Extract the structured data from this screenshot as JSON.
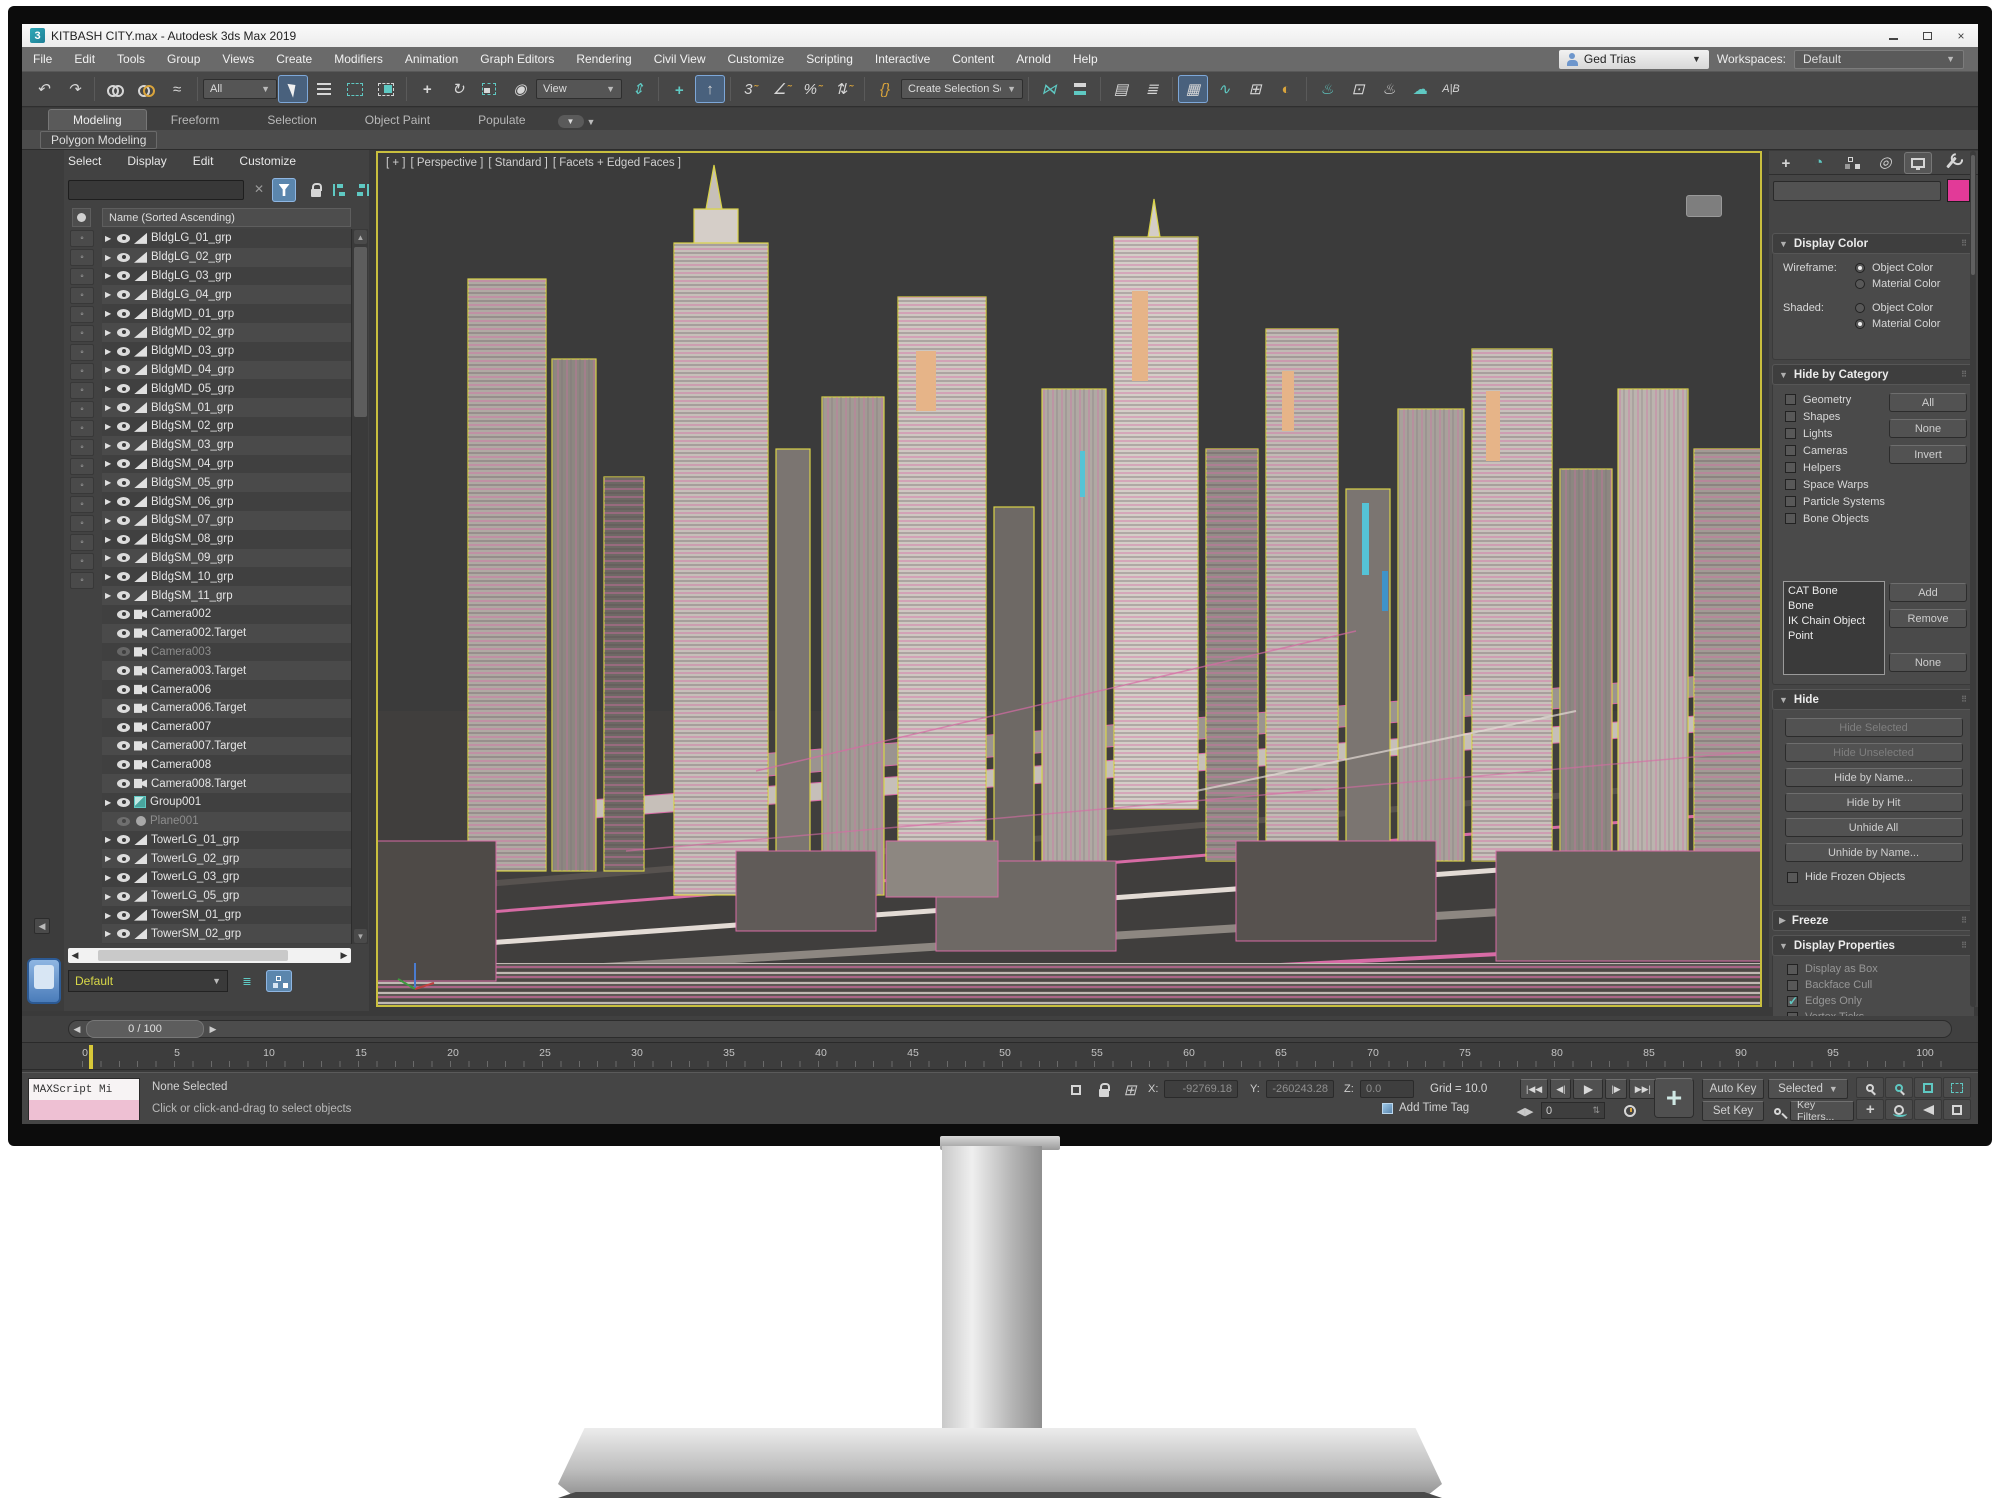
{
  "window": {
    "title": "KITBASH CITY.max - Autodesk 3ds Max 2019",
    "logo": "3"
  },
  "menubar": {
    "items": [
      "File",
      "Edit",
      "Tools",
      "Group",
      "Views",
      "Create",
      "Modifiers",
      "Animation",
      "Graph Editors",
      "Rendering",
      "Civil View",
      "Customize",
      "Scripting",
      "Interactive",
      "Content",
      "Arnold",
      "Help"
    ],
    "user": "Ged Trias",
    "workspaces_label": "Workspaces:",
    "workspace_value": "Default"
  },
  "toolbar": {
    "selection_filter": "All",
    "reference_coordinate": "View",
    "named_sets": "Create Selection Se",
    "icon_names": [
      "undo",
      "redo",
      "select-and-link",
      "unlink-selection",
      "bind-to-space-warp",
      "select-object",
      "select-by-name",
      "rectangular-selection-region",
      "window-crossing",
      "select-and-move",
      "select-and-rotate",
      "select-and-scale",
      "select-and-place",
      "use-pivot-point-center",
      "select-and-manipulate",
      "keyboard-shortcut-override",
      "snap-toggle-3d",
      "angle-snap",
      "percent-snap",
      "spinner-snap",
      "edit-named-selection-sets",
      "mirror",
      "align",
      "toggle-scene-explorer",
      "toggle-layer-explorer",
      "toggle-ribbon",
      "curve-editor",
      "schematic-view",
      "material-editor",
      "render-setup",
      "rendered-frame-window",
      "render-production",
      "render-in-cloud",
      "state-sets"
    ]
  },
  "ribbon": {
    "tabs": [
      {
        "label": "Modeling",
        "active": true
      },
      {
        "label": "Freeform"
      },
      {
        "label": "Selection"
      },
      {
        "label": "Object Paint"
      },
      {
        "label": "Populate"
      }
    ],
    "panel": "Polygon Modeling"
  },
  "explorer": {
    "menus": [
      "Select",
      "Display",
      "Edit",
      "Customize"
    ],
    "column_header": "Name (Sorted Ascending)",
    "side_icons": [
      "select-cursor",
      "geometry",
      "shapes",
      "lights",
      "cameras",
      "helpers",
      "space-warps",
      "particle-systems",
      "bones",
      "ik-objects",
      "containers",
      "materials",
      "layers",
      "groups",
      "xrefs",
      "display-frozen",
      "display-hidden",
      "sort",
      "pin"
    ],
    "items": [
      {
        "name": "BldgLG_01_grp",
        "icon": "grp"
      },
      {
        "name": "BldgLG_02_grp",
        "icon": "grp"
      },
      {
        "name": "BldgLG_03_grp",
        "icon": "grp"
      },
      {
        "name": "BldgLG_04_grp",
        "icon": "grp"
      },
      {
        "name": "BldgMD_01_grp",
        "icon": "grp"
      },
      {
        "name": "BldgMD_02_grp",
        "icon": "grp"
      },
      {
        "name": "BldgMD_03_grp",
        "icon": "grp"
      },
      {
        "name": "BldgMD_04_grp",
        "icon": "grp"
      },
      {
        "name": "BldgMD_05_grp",
        "icon": "grp"
      },
      {
        "name": "BldgSM_01_grp",
        "icon": "grp"
      },
      {
        "name": "BldgSM_02_grp",
        "icon": "grp"
      },
      {
        "name": "BldgSM_03_grp",
        "icon": "grp"
      },
      {
        "name": "BldgSM_04_grp",
        "icon": "grp"
      },
      {
        "name": "BldgSM_05_grp",
        "icon": "grp"
      },
      {
        "name": "BldgSM_06_grp",
        "icon": "grp"
      },
      {
        "name": "BldgSM_07_grp",
        "icon": "grp"
      },
      {
        "name": "BldgSM_08_grp",
        "icon": "grp"
      },
      {
        "name": "BldgSM_09_grp",
        "icon": "grp"
      },
      {
        "name": "BldgSM_10_grp",
        "icon": "grp"
      },
      {
        "name": "BldgSM_11_grp",
        "icon": "grp"
      },
      {
        "name": "Camera002",
        "icon": "cam",
        "noarrow": true
      },
      {
        "name": "Camera002.Target",
        "icon": "cam",
        "noarrow": true
      },
      {
        "name": "Camera003",
        "icon": "cam",
        "noarrow": true,
        "dim": true
      },
      {
        "name": "Camera003.Target",
        "icon": "cam",
        "noarrow": true
      },
      {
        "name": "Camera006",
        "icon": "cam",
        "noarrow": true
      },
      {
        "name": "Camera006.Target",
        "icon": "cam",
        "noarrow": true
      },
      {
        "name": "Camera007",
        "icon": "cam",
        "noarrow": true
      },
      {
        "name": "Camera007.Target",
        "icon": "cam",
        "noarrow": true
      },
      {
        "name": "Camera008",
        "icon": "cam",
        "noarrow": true
      },
      {
        "name": "Camera008.Target",
        "icon": "cam",
        "noarrow": true
      },
      {
        "name": "Group001",
        "icon": "group"
      },
      {
        "name": "Plane001",
        "icon": "plane",
        "noarrow": true,
        "dim": true
      },
      {
        "name": "TowerLG_01_grp",
        "icon": "grp"
      },
      {
        "name": "TowerLG_02_grp",
        "icon": "grp"
      },
      {
        "name": "TowerLG_03_grp",
        "icon": "grp"
      },
      {
        "name": "TowerLG_05_grp",
        "icon": "grp"
      },
      {
        "name": "TowerSM_01_grp",
        "icon": "grp"
      },
      {
        "name": "TowerSM_02_grp",
        "icon": "grp"
      }
    ],
    "layer_value": "Default"
  },
  "viewport": {
    "label_general": "[ + ]",
    "label_pov": "[ Perspective ]",
    "label_style": "[ Standard ]",
    "label_shading": "[ Facets + Edged Faces ]"
  },
  "cp": {
    "object_color": "#e23a98",
    "display_color": {
      "title": "Display Color",
      "wireframe_label": "Wireframe:",
      "shaded_label": "Shaded:",
      "object_color": "Object Color",
      "material_color": "Material Color"
    },
    "hbc": {
      "title": "Hide by Category",
      "categories": [
        {
          "label": "Geometry"
        },
        {
          "label": "Shapes"
        },
        {
          "label": "Lights"
        },
        {
          "label": "Cameras"
        },
        {
          "label": "Helpers"
        },
        {
          "label": "Space Warps"
        },
        {
          "label": "Particle Systems"
        },
        {
          "label": "Bone Objects"
        }
      ],
      "all": "All",
      "none": "None",
      "invert": "Invert",
      "sublist": [
        "CAT Bone",
        "Bone",
        "IK Chain Object",
        "Point"
      ],
      "add": "Add",
      "remove": "Remove",
      "none2": "None"
    },
    "hide": {
      "title": "Hide",
      "buttons": [
        {
          "label": "Hide Selected",
          "dim": true
        },
        {
          "label": "Hide Unselected",
          "dim": true
        },
        {
          "label": "Hide by Name..."
        },
        {
          "label": "Hide by Hit"
        },
        {
          "label": "Unhide All"
        },
        {
          "label": "Unhide by Name..."
        }
      ],
      "checkbox": "Hide Frozen Objects"
    },
    "freeze": {
      "title": "Freeze"
    },
    "dp": {
      "title": "Display Properties",
      "checks": [
        {
          "label": "Display as Box",
          "dim": true
        },
        {
          "label": "Backface Cull",
          "dim": true
        },
        {
          "label": "Edges Only",
          "dim": true,
          "checked": true
        },
        {
          "label": "Vertex Ticks",
          "dim": true
        }
      ]
    }
  },
  "timeline": {
    "slider": "0 / 100",
    "ticks": [
      "0",
      "5",
      "10",
      "15",
      "20",
      "25",
      "30",
      "35",
      "40",
      "45",
      "50",
      "55",
      "60",
      "65",
      "70",
      "75",
      "80",
      "85",
      "90",
      "95",
      "100"
    ]
  },
  "status": {
    "maxscript": "MAXScript Mi",
    "prompt1": "None Selected",
    "prompt2": "Click or click-and-drag to select objects",
    "x_label": "X:",
    "x": "-92769.18",
    "y_label": "Y:",
    "y": "-260243.28",
    "z_label": "Z:",
    "z": "0.0",
    "grid": "Grid = 10.0",
    "add_time_tag": "Add Time Tag",
    "frame": "0",
    "auto_key": "Auto Key",
    "selected": "Selected",
    "set_key": "Set Key",
    "key_filters": "Key Filters..."
  },
  "colors": {
    "accent_teal": "#5fc9c3",
    "highlight_blue": "#5b86ad",
    "selection_yellow": "#d9d348",
    "edge_pink": "#d76ba5",
    "object_color_swatch": "#e23a98"
  }
}
